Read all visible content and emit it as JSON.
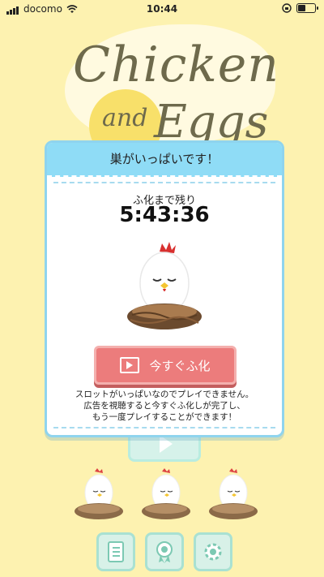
{
  "status_bar": {
    "carrier": "docomo",
    "time": "10:44",
    "battery_level": 0.5
  },
  "logo": {
    "line1": "Chicken",
    "line2": "and",
    "line3": "Eggs"
  },
  "dialog": {
    "title": "巣がいっぱいです！",
    "hatch_label": "ふ化まで残り",
    "timer": "5:43:36",
    "hatch_button_label": "今すぐふ化",
    "description_lines": [
      "スロットがいっぱいなのでプレイできません。",
      "広告を視聴すると今すぐふ化しが完了し、",
      "もう一度プレイすることができます！"
    ]
  },
  "nest_slots_count": 3,
  "bottom_buttons": [
    "notebook-icon",
    "medal-icon",
    "gear-icon"
  ],
  "colors": {
    "background": "#fdf2b0",
    "dialog_header": "#8fdcf6",
    "hatch_button": "#ec7c7c"
  }
}
